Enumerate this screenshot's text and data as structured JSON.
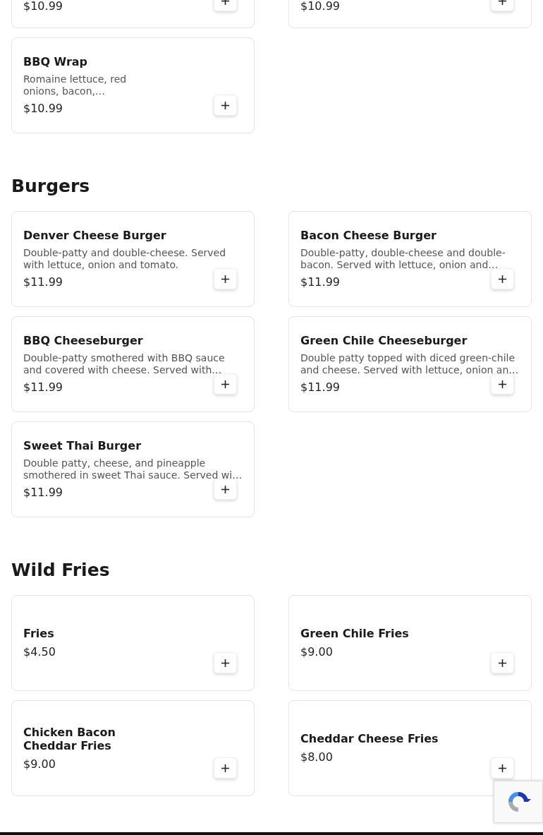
{
  "sections": [
    {
      "items": [
        {
          "price": "$10.99"
        },
        {
          "price": "$10.99"
        },
        {
          "name": "BBQ Wrap",
          "description": "Romaine lettuce, red onions, bacon,…",
          "narrow": true,
          "price": "$10.99"
        }
      ]
    },
    {
      "heading": "Burgers",
      "items": [
        {
          "name": "Denver Cheese Burger",
          "description": "Double-patty and double-cheese. Served with lettuce, onion and tomato.",
          "price": "$11.99"
        },
        {
          "name": "Bacon Cheese Burger",
          "description": "Double-patty, double-cheese and double-bacon. Served with lettuce, onion and…",
          "price": "$11.99"
        },
        {
          "name": "BBQ Cheeseburger",
          "description": "Double-patty smothered with BBQ sauce and covered with cheese. Served with…",
          "price": "$11.99"
        },
        {
          "name": "Green Chile Cheeseburger",
          "description": "Double patty topped with diced green-chile and cheese. Served with lettuce, onion an…",
          "price": "$11.99"
        },
        {
          "name": "Sweet Thai Burger",
          "description": "Double patty, cheese, and pineapple smothered in sweet Thai sauce. Served wi…",
          "price": "$11.99"
        }
      ]
    },
    {
      "heading": "Wild Fries",
      "items": [
        {
          "name": "Fries",
          "price": "$4.50"
        },
        {
          "name": "Green Chile Fries",
          "price": "$9.00"
        },
        {
          "name": "Chicken Bacon Cheddar Fries",
          "narrow": true,
          "price": "$9.00"
        },
        {
          "name": "Cheddar Cheese Fries",
          "price": "$8.00"
        }
      ]
    }
  ]
}
